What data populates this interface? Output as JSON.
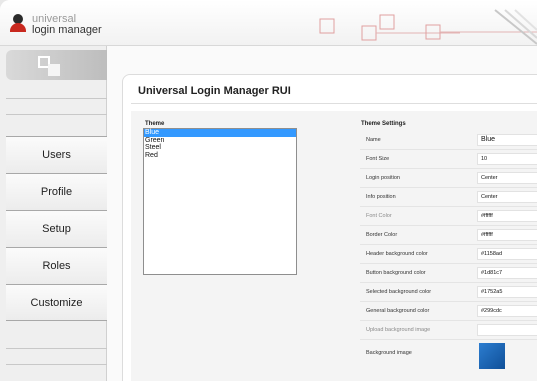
{
  "brand": {
    "line1": "universal",
    "line2": "login manager"
  },
  "sidebar": {
    "items": [
      {
        "label": "Users"
      },
      {
        "label": "Profile"
      },
      {
        "label": "Setup"
      },
      {
        "label": "Roles"
      },
      {
        "label": "Customize"
      }
    ]
  },
  "main": {
    "title": "Universal Login Manager RUI",
    "theme_label": "Theme",
    "themes": [
      "Blue",
      "Green",
      "Steel",
      "Red"
    ],
    "selected_theme": "Blue",
    "settings_label": "Theme Settings",
    "settings": [
      {
        "label": "Name",
        "value": "Blue"
      },
      {
        "label": "Font Size",
        "value": "10"
      },
      {
        "label": "Login position",
        "value": "Center"
      },
      {
        "label": "Info position",
        "value": "Center"
      },
      {
        "label": "Font Color",
        "value": "#ffffff"
      },
      {
        "label": "Border Color",
        "value": "#ffffff"
      },
      {
        "label": "Header background color",
        "value": "#1158ad"
      },
      {
        "label": "Button background color",
        "value": "#1d81c7"
      },
      {
        "label": "Selected background color",
        "value": "#1752a5"
      },
      {
        "label": "General background color",
        "value": "#299cdc"
      },
      {
        "label": "Upload background image",
        "value": ""
      },
      {
        "label": "Background image",
        "value": ""
      }
    ]
  },
  "colors": {
    "selection": "#3399ff",
    "logo_red": "#c8281e",
    "swatch": "#1a66b8"
  }
}
